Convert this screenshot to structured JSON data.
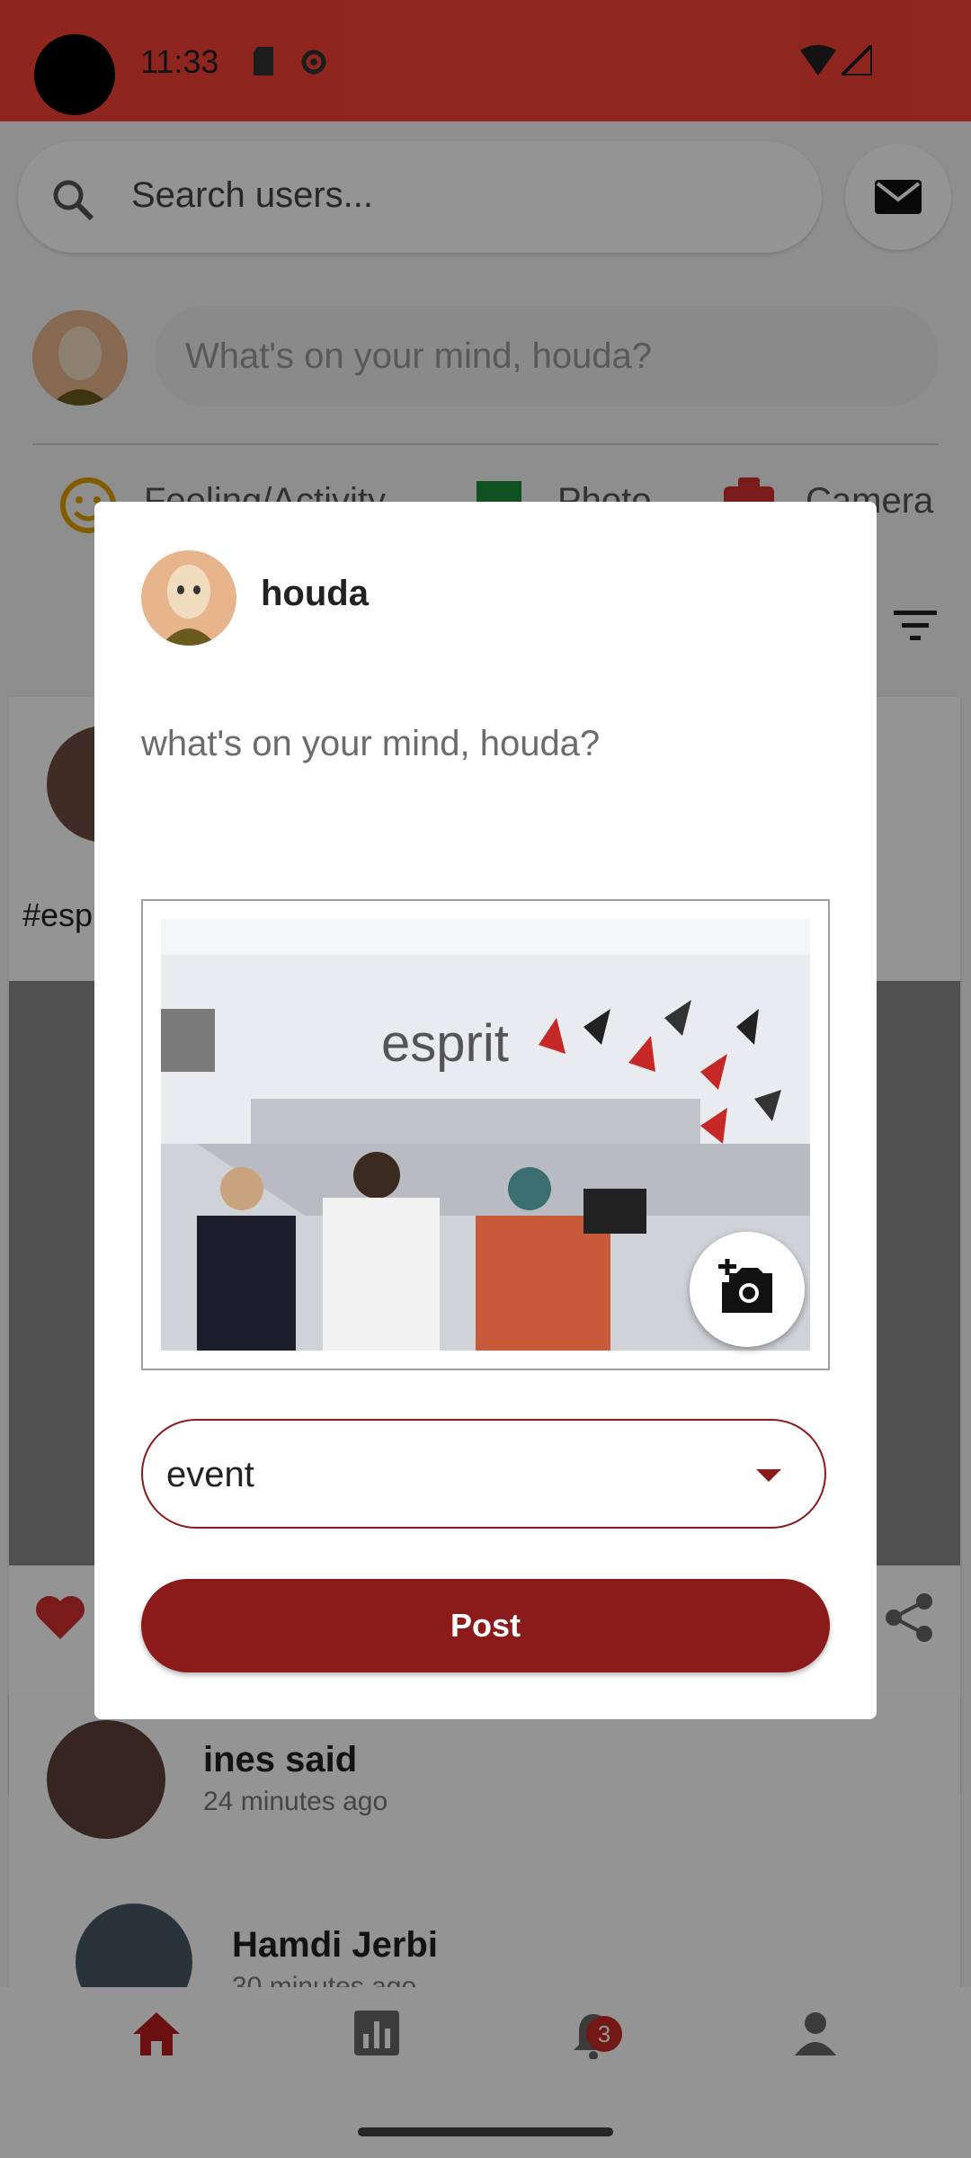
{
  "status_bar": {
    "time": "11:33"
  },
  "header": {
    "search_placeholder": "Search users..."
  },
  "composer": {
    "prompt": "What's on your mind, houda?",
    "actions": [
      "Feeling/Activity",
      "Photo",
      "Camera"
    ]
  },
  "feed": {
    "hashtag_fragment": "#esp",
    "comments": [
      {
        "author": "ines said",
        "time": "24 minutes ago"
      },
      {
        "author": "Hamdi Jerbi",
        "time": "30 minutes ago"
      }
    ]
  },
  "bottom_nav": {
    "notification_count": "3"
  },
  "dialog": {
    "user_name": "houda",
    "prompt": "what's on your mind, houda?",
    "image_text": "esprit",
    "category_value": "event",
    "post_label": "Post"
  },
  "colors": {
    "status_bar": "#f44336",
    "accent": "#8b1a1a"
  }
}
